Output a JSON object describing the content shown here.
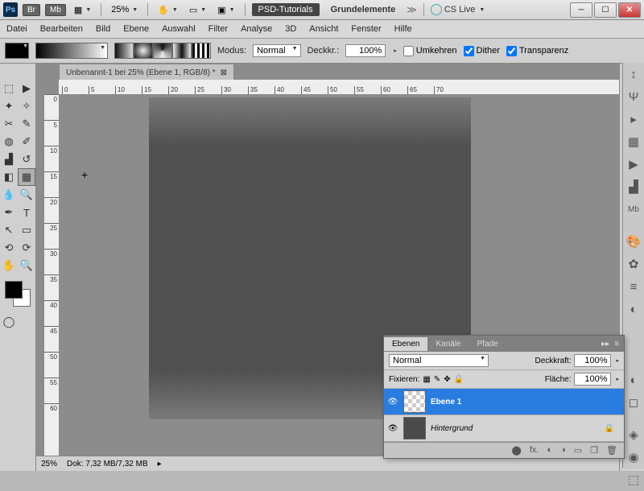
{
  "title": {
    "psd_tut": "PSD-Tutorials",
    "grund": "Grundelemente",
    "cs": "CS Live",
    "zoom_title": "25%"
  },
  "menu": {
    "datei": "Datei",
    "bearbeiten": "Bearbeiten",
    "bild": "Bild",
    "ebene": "Ebene",
    "auswahl": "Auswahl",
    "filter": "Filter",
    "analyse": "Analyse",
    "dd": "3D",
    "ansicht": "Ansicht",
    "fenster": "Fenster",
    "hilfe": "Hilfe"
  },
  "opt": {
    "modus": "Modus:",
    "modus_val": "Normal",
    "deckkr": "Deckkr.:",
    "deckkr_val": "100%",
    "umkehren": "Umkehren",
    "dither": "Dither",
    "transp": "Transparenz"
  },
  "doc": {
    "tab": "Unbenannt-1 bei 25% (Ebene 1, RGB/8) *"
  },
  "ruler": [
    "0",
    "5",
    "10",
    "15",
    "20",
    "25",
    "30",
    "35",
    "40",
    "45",
    "50",
    "55",
    "60",
    "65",
    "70"
  ],
  "rulerv": [
    "0",
    "5",
    "10",
    "15",
    "20",
    "25",
    "30",
    "35",
    "40",
    "45",
    "50",
    "55",
    "60"
  ],
  "layers": {
    "tab_ebenen": "Ebenen",
    "tab_kanale": "Kanäle",
    "tab_pfade": "Pfade",
    "mode": "Normal",
    "deckkraft": "Deckkraft:",
    "deckkraft_val": "100%",
    "fixieren": "Fixieren:",
    "flaeche": "Fläche:",
    "flaeche_val": "100%",
    "l1": "Ebene 1",
    "bg": "Hintergrund"
  },
  "status": {
    "zoom": "25%",
    "dok": "Dok: 7,32 MB/7,32 MB"
  },
  "tb_icons": {
    "br": "Br",
    "mb": "Mb"
  }
}
